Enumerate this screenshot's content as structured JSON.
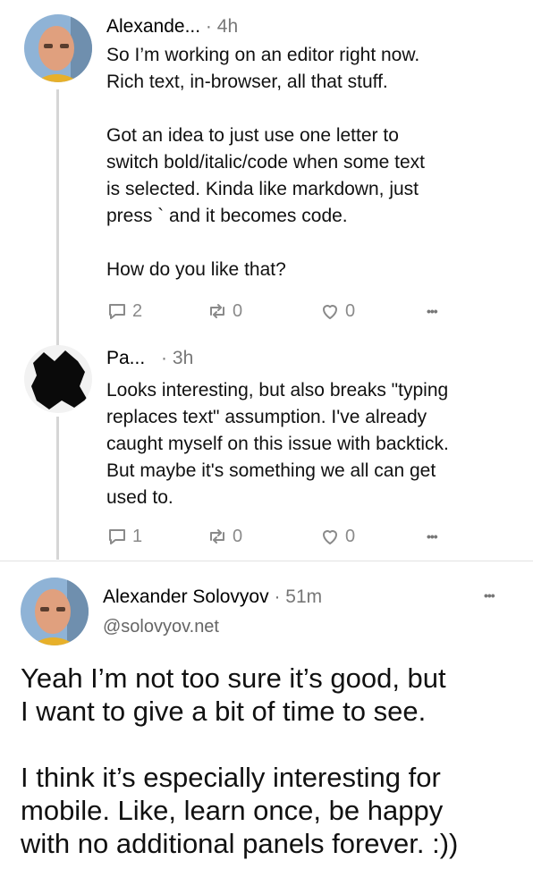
{
  "posts": [
    {
      "author": "Alexande...",
      "time": "4h",
      "text": "So I’m working on an editor right now.\nRich text, in-browser, all that stuff.\n\nGot an idea to just use one letter to\nswitch bold/italic/code when some text\nis selected. Kinda like markdown, just\npress ` and it becomes code.\n\nHow do you like that?",
      "replies": "2",
      "reposts": "0",
      "likes": "0"
    },
    {
      "author": "Pa...",
      "time": "3h",
      "text": "Looks interesting, but also breaks \"typing\nreplaces text\" assumption. I've already\ncaught myself on this issue with backtick.\nBut maybe it's something we all can get\nused to.",
      "replies": "1",
      "reposts": "0",
      "likes": "0"
    }
  ],
  "main_post": {
    "author": "Alexander Solovyov",
    "time": "51m",
    "handle": "@solovyov.net",
    "text": "Yeah I’m not too sure it’s good, but\nI want to give a bit of time to see.\n\nI think it’s especially interesting for\nmobile. Like, learn once, be happy\nwith no additional panels forever. :))"
  },
  "separator": "·",
  "more_glyph": "•••",
  "colors": {
    "meta": "#777777",
    "line": "#d6d6d6",
    "action": "#8a8a8a"
  }
}
